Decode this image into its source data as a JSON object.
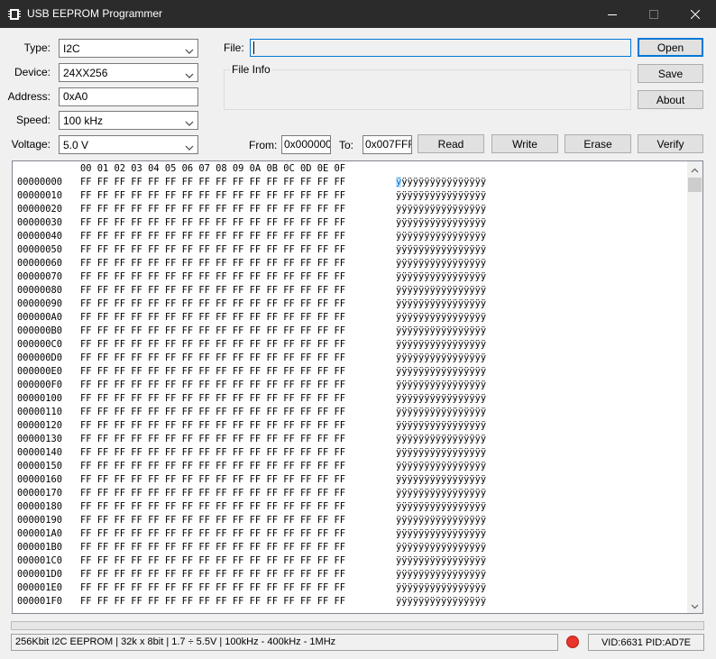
{
  "window": {
    "title": "USB EEPROM Programmer"
  },
  "settings": {
    "type_label": "Type:",
    "type_value": "I2C",
    "device_label": "Device:",
    "device_value": "24XX256",
    "address_label": "Address:",
    "address_value": "0xA0",
    "speed_label": "Speed:",
    "speed_value": "100 kHz",
    "voltage_label": "Voltage:",
    "voltage_value": "5.0 V"
  },
  "file": {
    "label": "File:",
    "value": "",
    "info_legend": "File Info"
  },
  "buttons": {
    "open": "Open",
    "save": "Save",
    "about": "About",
    "read": "Read",
    "write": "Write",
    "erase": "Erase",
    "verify": "Verify"
  },
  "range": {
    "from_label": "From:",
    "from_value": "0x000000",
    "to_label": "To:",
    "to_value": "0x007FFF"
  },
  "hex": {
    "header": "00 01 02 03 04 05 06 07 08 09 0A 0B 0C 0D 0E 0F",
    "byte_value": "FF",
    "ascii_char": "ÿ",
    "rows": [
      "00000000",
      "00000010",
      "00000020",
      "00000030",
      "00000040",
      "00000050",
      "00000060",
      "00000070",
      "00000080",
      "00000090",
      "000000A0",
      "000000B0",
      "000000C0",
      "000000D0",
      "000000E0",
      "000000F0",
      "00000100",
      "00000110",
      "00000120",
      "00000130",
      "00000140",
      "00000150",
      "00000160",
      "00000170",
      "00000180",
      "00000190",
      "000001A0",
      "000001B0",
      "000001C0",
      "000001D0",
      "000001E0",
      "000001F0"
    ],
    "selected_row": 0,
    "selected_col": 0
  },
  "status": {
    "device_info": "256Kbit I2C EEPROM | 32k x 8bit | 1.7 ÷ 5.5V | 100kHz - 400kHz - 1MHz",
    "vid_pid": "VID:6631 PID:AD7E",
    "led_color": "#e8342a",
    "progress_percent": 0
  },
  "icons": {
    "app": "chip-icon",
    "minimize": "minimize-icon",
    "maximize": "maximize-icon",
    "close": "close-icon",
    "dropdown": "chevron-down-icon",
    "scroll_up": "scroll-up-icon",
    "scroll_down": "scroll-down-icon"
  }
}
